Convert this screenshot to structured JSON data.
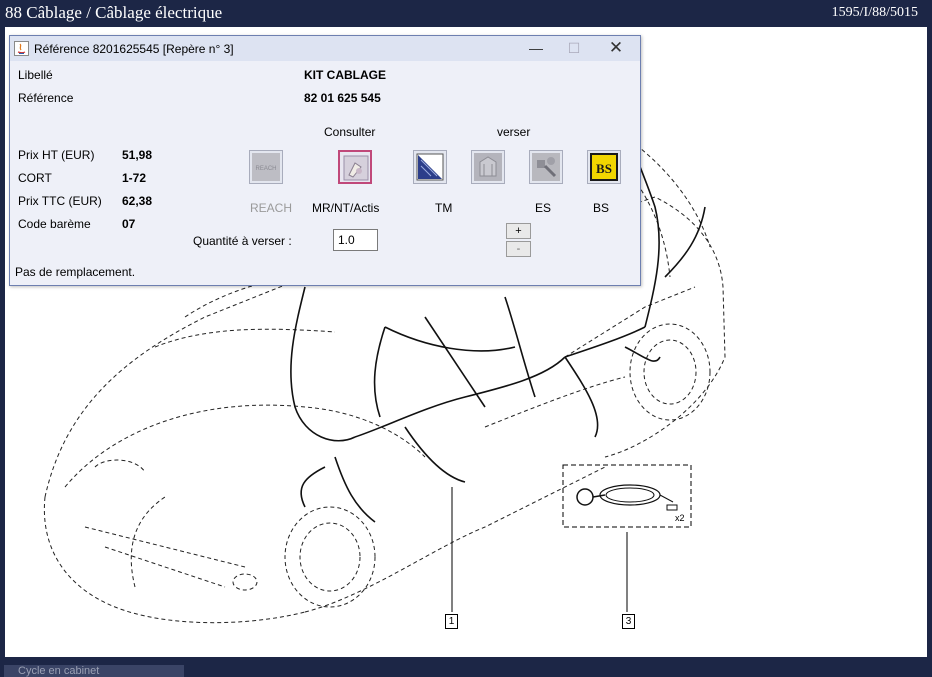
{
  "app": {
    "title": "88 Câblage / Câblage électrique",
    "reference_code": "1595/I/88/5015"
  },
  "bottom_tab": {
    "label": "Cycle en cabinet"
  },
  "drawing": {
    "callouts": [
      "1",
      "3"
    ],
    "detail_label": "x2"
  },
  "dialog": {
    "title": "Référence 8201625545 [Repère n° 3]",
    "fields": {
      "libelle_label": "Libellé",
      "libelle_value": "KIT CABLAGE",
      "reference_label": "Référence",
      "reference_value": "82 01 625 545",
      "prix_ht_label": "Prix HT (EUR)",
      "prix_ht_value": "51,98",
      "cort_label": "CORT",
      "cort_value": "1-72",
      "prix_ttc_label": "Prix TTC (EUR)",
      "prix_ttc_value": "62,38",
      "code_bareme_label": "Code barème",
      "code_bareme_value": "07"
    },
    "section_consulter": "Consulter",
    "section_verser": "verser",
    "buttons": {
      "reach": "REACH",
      "reach_icon_text": "REACH",
      "mr": "MR/NT/Actis",
      "tm": "TM",
      "es": "ES",
      "bs": "BS",
      "bs_icon_text": "BS"
    },
    "quantity_label": "Quantité à verser :",
    "quantity_value": "1.0",
    "plus": "+",
    "minus": "-",
    "status": "Pas de remplacement."
  },
  "colors": {
    "chrome": "#1c2646",
    "dialog_bg": "#eef0f8",
    "selected_border": "#c0487a",
    "bs_yellow": "#f2d600"
  }
}
